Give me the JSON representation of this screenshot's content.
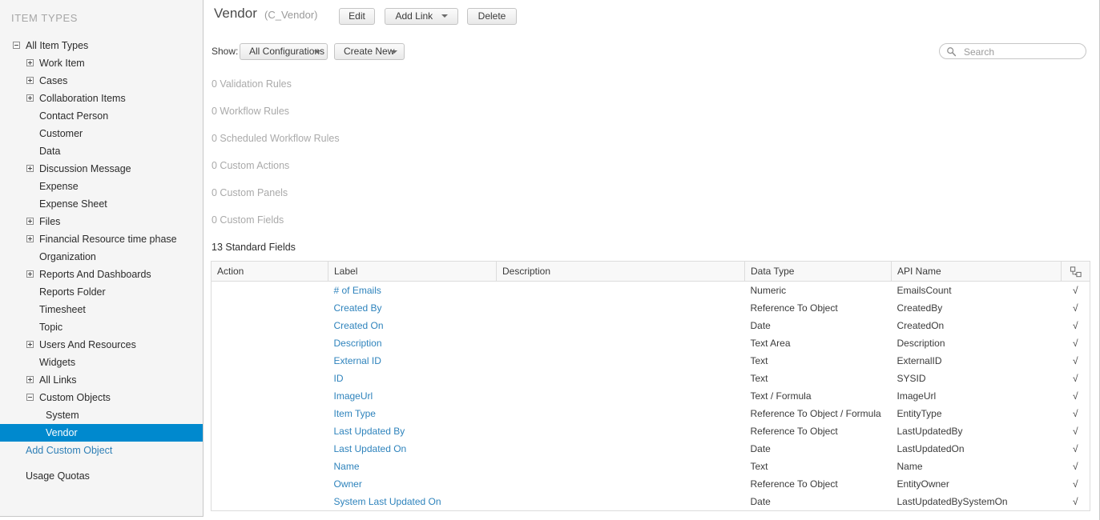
{
  "sidebar": {
    "title": "ITEM TYPES",
    "tree": [
      {
        "label": "All Item Types",
        "level": 0,
        "twisty": "minus",
        "kind": "plain"
      },
      {
        "label": "Work Item",
        "level": 1,
        "twisty": "plus",
        "kind": "plain"
      },
      {
        "label": "Cases",
        "level": 1,
        "twisty": "plus",
        "kind": "plain"
      },
      {
        "label": "Collaboration Items",
        "level": 1,
        "twisty": "plus",
        "kind": "plain"
      },
      {
        "label": "Contact Person",
        "level": 1,
        "twisty": "none",
        "kind": "plain"
      },
      {
        "label": "Customer",
        "level": 1,
        "twisty": "none",
        "kind": "plain"
      },
      {
        "label": "Data",
        "level": 1,
        "twisty": "none",
        "kind": "plain"
      },
      {
        "label": "Discussion Message",
        "level": 1,
        "twisty": "plus",
        "kind": "plain"
      },
      {
        "label": "Expense",
        "level": 1,
        "twisty": "none",
        "kind": "plain"
      },
      {
        "label": "Expense Sheet",
        "level": 1,
        "twisty": "none",
        "kind": "plain"
      },
      {
        "label": "Files",
        "level": 1,
        "twisty": "plus",
        "kind": "plain"
      },
      {
        "label": "Financial Resource time phase",
        "level": 1,
        "twisty": "plus",
        "kind": "plain"
      },
      {
        "label": "Organization",
        "level": 1,
        "twisty": "none",
        "kind": "plain"
      },
      {
        "label": "Reports And Dashboards",
        "level": 1,
        "twisty": "plus",
        "kind": "plain"
      },
      {
        "label": "Reports Folder",
        "level": 1,
        "twisty": "none",
        "kind": "plain"
      },
      {
        "label": "Timesheet",
        "level": 1,
        "twisty": "none",
        "kind": "plain"
      },
      {
        "label": "Topic",
        "level": 1,
        "twisty": "none",
        "kind": "plain"
      },
      {
        "label": "Users And Resources",
        "level": 1,
        "twisty": "plus",
        "kind": "plain"
      },
      {
        "label": "Widgets",
        "level": 1,
        "twisty": "none",
        "kind": "plain"
      },
      {
        "label": "All Links",
        "level": 1,
        "twisty": "plus",
        "kind": "plain"
      },
      {
        "label": "Custom Objects",
        "level": 1,
        "twisty": "minus",
        "kind": "plain"
      },
      {
        "label": "System",
        "level": 2,
        "twisty": "none",
        "kind": "plain"
      },
      {
        "label": "Vendor",
        "level": 2,
        "twisty": "none",
        "kind": "selected"
      },
      {
        "label": "Add Custom Object",
        "level": 0,
        "twisty": "none",
        "kind": "link"
      },
      {
        "label": "",
        "level": 0,
        "twisty": "none",
        "kind": "spacer"
      },
      {
        "label": "Usage Quotas",
        "level": 0,
        "twisty": "none",
        "kind": "plain"
      }
    ]
  },
  "header": {
    "title": "Vendor",
    "subtitle": "(C_Vendor)",
    "edit_label": "Edit",
    "add_link_label": "Add Link",
    "delete_label": "Delete"
  },
  "toolbar": {
    "show_label": "Show:",
    "configurations_value": "All Configurations",
    "create_new_label": "Create New",
    "search_placeholder": "Search",
    "search_value": "",
    "search_icon": "search-icon"
  },
  "sections": [
    {
      "text": "0 Validation Rules"
    },
    {
      "text": "0 Workflow Rules"
    },
    {
      "text": "0 Scheduled Workflow Rules"
    },
    {
      "text": "0 Custom Actions"
    },
    {
      "text": "0 Custom Panels"
    },
    {
      "text": "0 Custom Fields"
    }
  ],
  "table": {
    "caption": "13 Standard Fields",
    "columns": [
      "Action",
      "Label",
      "Description",
      "Data Type",
      "API Name"
    ],
    "last_column_icon": "copy-fields-icon",
    "check_glyph": "√",
    "rows": [
      {
        "action": "",
        "label": "# of Emails",
        "description": "",
        "data_type": "Numeric",
        "api_name": "EmailsCount",
        "checked": true
      },
      {
        "action": "",
        "label": "Created By",
        "description": "",
        "data_type": "Reference To Object",
        "api_name": "CreatedBy",
        "checked": true
      },
      {
        "action": "",
        "label": "Created On",
        "description": "",
        "data_type": "Date",
        "api_name": "CreatedOn",
        "checked": true
      },
      {
        "action": "",
        "label": "Description",
        "description": "",
        "data_type": "Text Area",
        "api_name": "Description",
        "checked": true
      },
      {
        "action": "",
        "label": "External ID",
        "description": "",
        "data_type": "Text",
        "api_name": "ExternalID",
        "checked": true
      },
      {
        "action": "",
        "label": "ID",
        "description": "",
        "data_type": "Text",
        "api_name": "SYSID",
        "checked": true
      },
      {
        "action": "",
        "label": "ImageUrl",
        "description": "",
        "data_type": "Text / Formula",
        "api_name": "ImageUrl",
        "checked": true
      },
      {
        "action": "",
        "label": "Item Type",
        "description": "",
        "data_type": "Reference To Object / Formula",
        "api_name": "EntityType",
        "checked": true
      },
      {
        "action": "",
        "label": "Last Updated By",
        "description": "",
        "data_type": "Reference To Object",
        "api_name": "LastUpdatedBy",
        "checked": true
      },
      {
        "action": "",
        "label": "Last Updated On",
        "description": "",
        "data_type": "Date",
        "api_name": "LastUpdatedOn",
        "checked": true
      },
      {
        "action": "",
        "label": "Name",
        "description": "",
        "data_type": "Text",
        "api_name": "Name",
        "checked": true
      },
      {
        "action": "",
        "label": "Owner",
        "description": "",
        "data_type": "Reference To Object",
        "api_name": "EntityOwner",
        "checked": true
      },
      {
        "action": "",
        "label": "System Last Updated On",
        "description": "",
        "data_type": "Date",
        "api_name": "LastUpdatedBySystemOn",
        "checked": true
      }
    ]
  },
  "colors": {
    "accent": "#0089ce",
    "link": "#2e83bc",
    "sidebar_bg": "#f5f5f5",
    "muted_text": "#aaaaaa"
  }
}
